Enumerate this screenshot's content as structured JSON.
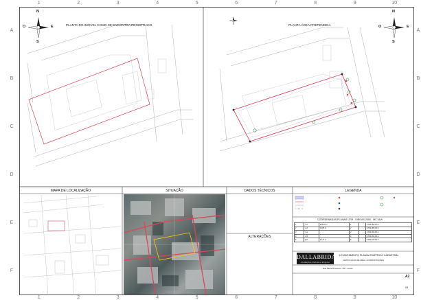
{
  "grid": {
    "columns": [
      "1",
      "2",
      "3",
      "4",
      "5",
      "6",
      "7",
      "8",
      "9",
      "10"
    ],
    "rows": [
      "A",
      "B",
      "C",
      "D",
      "E",
      "F"
    ]
  },
  "compass": {
    "n": "N",
    "s": "S",
    "e": "E",
    "o": "O"
  },
  "left_plan": {
    "title": "PLANTA DO IMÓVEL COMO SE ENCONTRA REGISTRADO"
  },
  "right_plan": {
    "title": "PLANTA ÁREA PRETENDIDA"
  },
  "panels": {
    "mapa": "MAPA DE LOCALIZAÇÃO",
    "situacao": "SITUAÇÃO",
    "dados": "DADOS TÉCNICOS",
    "legenda": "LEGENDA",
    "alteracoes": "ALTERAÇÕES"
  },
  "coordinates": {
    "title": "COORDENADAS PLANAS UTM - SIRGAS 2000 - MC 51W",
    "rows": [
      [
        "1",
        "1-2",
        "101,60 m",
        "1",
        "",
        "6.790.362,10 m"
      ],
      [
        "2",
        "2-3",
        "70,86 m",
        "2",
        "",
        "6.790.382,00 m"
      ],
      [
        "3",
        "3-4",
        "",
        "3",
        "",
        "6.790.366,00 m"
      ],
      [
        "4",
        "4-5",
        "",
        "4",
        "",
        "6.790.364,00 m"
      ],
      [
        "5",
        "5-6",
        "72,71 m",
        "5",
        "",
        "6.790.376,00 m"
      ]
    ]
  },
  "titleblock": {
    "company": "DALLABRIDA",
    "company_sub": "Avaliações, Perícias e Projetos",
    "project": "LEVANTAMENTO PLANIALTIMÉTRICO CADASTRAL",
    "subtitle": "RETIFICAÇÃO DE ÁREA, CONFRONTAÇÕES",
    "address": "Rua Padre Domenico, 150 - Centro",
    "sheet": "A2",
    "sheet_num": "01"
  },
  "colors": {
    "boundary": "#d9475a",
    "street": "#9a9a9a",
    "legend_purple": "#8a6fd1",
    "legend_green": "#2f9b44"
  }
}
